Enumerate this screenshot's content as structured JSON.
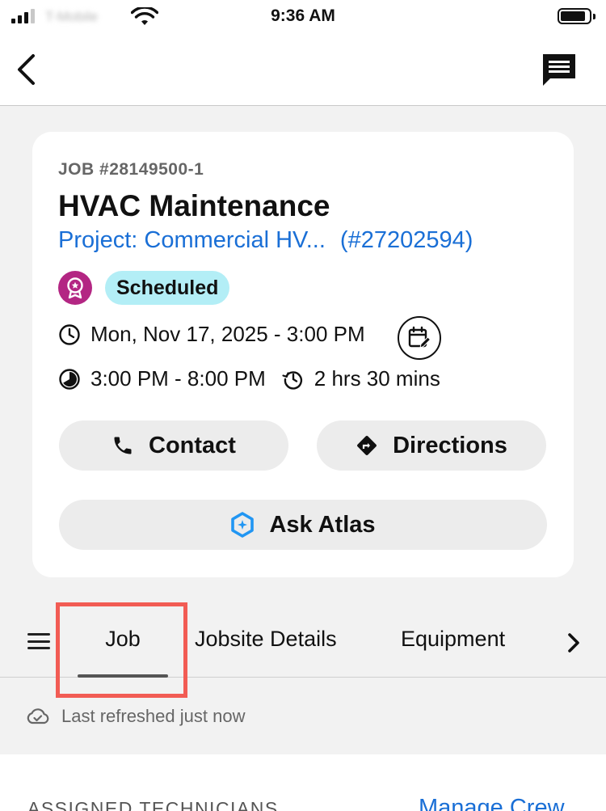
{
  "status_bar": {
    "carrier": "T-Mobile",
    "time": "9:36 AM"
  },
  "nav": {
    "back_icon": "chevron-left-icon",
    "message_icon": "message-icon"
  },
  "job": {
    "number": "JOB #28149500-1",
    "title": "HVAC Maintenance",
    "project_label": "Project: Commercial HV...",
    "project_id": "(#27202594)",
    "status": "Scheduled",
    "status_color": "#b3eef6",
    "award_color": "#b32683",
    "date": "Mon, Nov 17, 2025 - 3:00 PM",
    "window": "3:00 PM - 8:00 PM",
    "duration": "2 hrs 30 mins"
  },
  "actions": {
    "contact": "Contact",
    "directions": "Directions",
    "ask_atlas": "Ask Atlas"
  },
  "tabs": {
    "items": [
      {
        "label": "Job",
        "selected": true
      },
      {
        "label": "Jobsite Details",
        "selected": false
      },
      {
        "label": "Equipment",
        "selected": false
      }
    ]
  },
  "refresh": {
    "text": "Last refreshed just now"
  },
  "technicians": {
    "header": "ASSIGNED TECHNICIANS",
    "manage": "Manage Crew"
  },
  "colors": {
    "link": "#1a6fd6",
    "highlight": "#f25c54",
    "background": "#f2f2f2"
  }
}
